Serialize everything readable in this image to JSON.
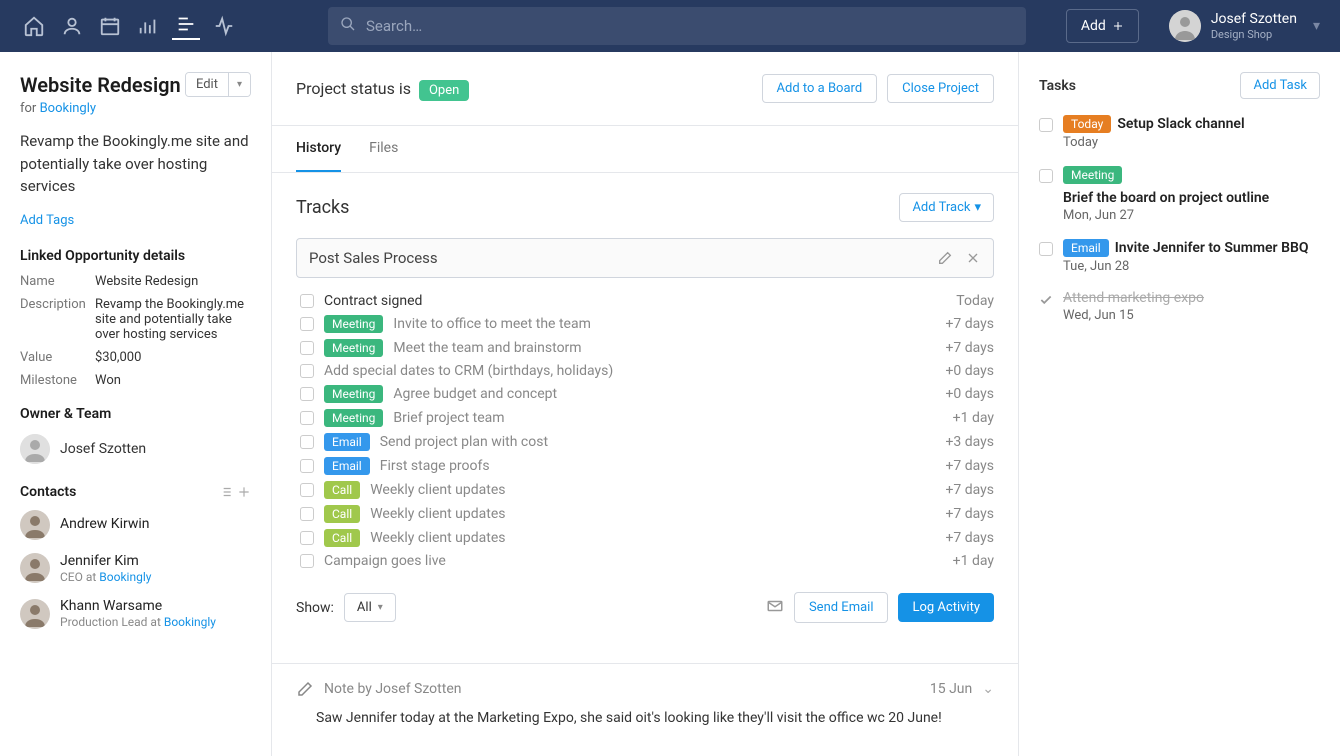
{
  "topnav": {
    "search_placeholder": "Search…",
    "add_label": "Add",
    "username": "Josef Szotten",
    "user_org": "Design Shop"
  },
  "sidebar": {
    "title": "Website Redesign",
    "edit_label": "Edit",
    "for_prefix": "for ",
    "for_link": "Bookingly",
    "description": "Revamp the Bookingly.me site and potentially take over hosting services",
    "add_tags_label": "Add Tags",
    "linked_title": "Linked Opportunity details",
    "details": {
      "name_label": "Name",
      "name_value": "Website Redesign",
      "desc_label": "Description",
      "desc_value": "Revamp the Bookingly.me site and potentially take over hosting services",
      "value_label": "Value",
      "value_value": "$30,000",
      "milestone_label": "Milestone",
      "milestone_value": "Won"
    },
    "owner_title": "Owner & Team",
    "owner_name": "Josef Szotten",
    "contacts_title": "Contacts",
    "contacts": [
      {
        "name": "Andrew Kirwin",
        "role": "",
        "company": ""
      },
      {
        "name": "Jennifer Kim",
        "role": "CEO at ",
        "company": "Bookingly"
      },
      {
        "name": "Khann Warsame",
        "role": "Production Lead at ",
        "company": "Bookingly"
      }
    ]
  },
  "main": {
    "status_prefix": "Project status is ",
    "status_badge": "Open",
    "add_board_label": "Add to a Board",
    "close_project_label": "Close Project",
    "tab_history": "History",
    "tab_files": "Files",
    "tracks_title": "Tracks",
    "add_track_label": "Add Track",
    "track_name": "Post Sales Process",
    "track_items": [
      {
        "tag": "",
        "text": "Contract signed",
        "days": "Today",
        "primary": true
      },
      {
        "tag": "Meeting",
        "text": "Invite to office to meet the team",
        "days": "+7 days"
      },
      {
        "tag": "Meeting",
        "text": "Meet the team and brainstorm",
        "days": "+7 days"
      },
      {
        "tag": "",
        "text": "Add special dates to CRM (birthdays, holidays)",
        "days": "+0 days"
      },
      {
        "tag": "Meeting",
        "text": "Agree budget and concept",
        "days": "+0 days"
      },
      {
        "tag": "Meeting",
        "text": "Brief project team",
        "days": "+1 day"
      },
      {
        "tag": "Email",
        "text": "Send project plan with cost",
        "days": "+3 days"
      },
      {
        "tag": "Email",
        "text": "First stage proofs",
        "days": "+7 days"
      },
      {
        "tag": "Call",
        "text": "Weekly client updates",
        "days": "+7 days"
      },
      {
        "tag": "Call",
        "text": "Weekly client updates",
        "days": "+7 days"
      },
      {
        "tag": "Call",
        "text": "Weekly client updates",
        "days": "+7 days"
      },
      {
        "tag": "",
        "text": "Campaign goes live",
        "days": "+1 day"
      }
    ],
    "show_label": "Show:",
    "show_value": "All",
    "send_email_label": "Send Email",
    "log_activity_label": "Log Activity",
    "note_by": "Note by Josef Szotten",
    "note_date": "15 Jun",
    "note_body": "Saw Jennifer today at the Marketing Expo, she said oit's looking like they'll visit the office wc 20 June!"
  },
  "rightbar": {
    "title": "Tasks",
    "add_task_label": "Add Task",
    "tasks": [
      {
        "tag": "Today",
        "tag_class": "tag-today",
        "name": "Setup Slack channel",
        "date": "Today",
        "done": false
      },
      {
        "tag": "Meeting",
        "tag_class": "tag-meeting",
        "name": "Brief the board on project outline",
        "date": "Mon, Jun 27",
        "done": false
      },
      {
        "tag": "Email",
        "tag_class": "tag-email",
        "name": "Invite Jennifer to Summer BBQ",
        "date": "Tue, Jun 28",
        "done": false
      },
      {
        "tag": "",
        "tag_class": "",
        "name": "Attend marketing expo",
        "date": "Wed, Jun 15",
        "done": true
      }
    ]
  }
}
